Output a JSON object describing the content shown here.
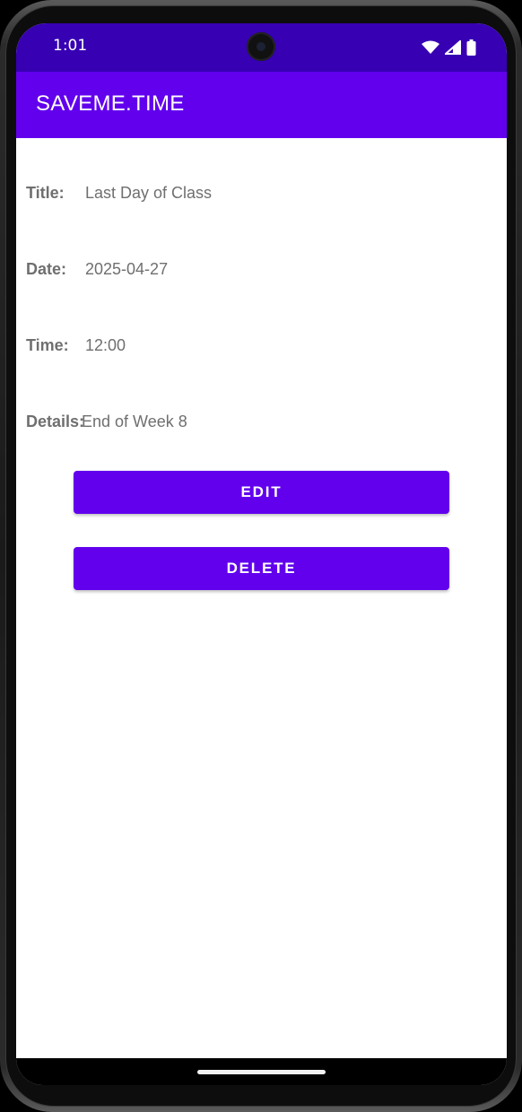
{
  "status_bar": {
    "time": "1:01",
    "icons": [
      "wifi-icon",
      "cell-signal-icon",
      "battery-icon"
    ]
  },
  "app_bar": {
    "title": "SAVEME.TIME"
  },
  "event": {
    "title_label": "Title:",
    "title_value": "Last Day of Class",
    "date_label": "Date:",
    "date_value": "2025-04-27",
    "time_label": "Time:",
    "time_value": "12:00",
    "details_label": "Details:",
    "details_value": "End of Week 8"
  },
  "actions": {
    "edit_label": "EDIT",
    "delete_label": "DELETE"
  },
  "colors": {
    "status_bar": "#3700b3",
    "primary": "#6200ee",
    "text_secondary": "#6f6f6f"
  }
}
